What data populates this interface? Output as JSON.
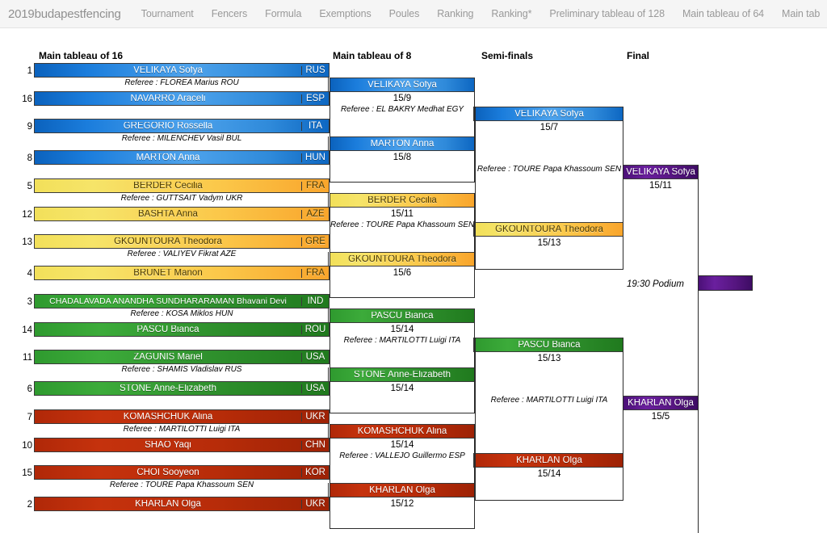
{
  "navbar": {
    "brand": "2019budapestfencing",
    "items": [
      {
        "label": "Tournament"
      },
      {
        "label": "Fencers"
      },
      {
        "label": "Formula"
      },
      {
        "label": "Exemptions"
      },
      {
        "label": "Poules"
      },
      {
        "label": "Ranking"
      },
      {
        "label": "Ranking*"
      },
      {
        "label": "Preliminary tableau of 128"
      },
      {
        "label": "Main tableau of 64"
      },
      {
        "label": "Main tab"
      }
    ]
  },
  "colors": {
    "blue": "#1b7ddc",
    "yellow": "#f6e469",
    "orange": "#f9a52c",
    "green": "#2e8f2c",
    "red": "#b72c09",
    "purple": "#55157f"
  },
  "columns": [
    {
      "label": "Main tableau of 16"
    },
    {
      "label": "Main tableau of 8"
    },
    {
      "label": "Semi-finals"
    },
    {
      "label": "Final"
    }
  ],
  "round_of_16": [
    {
      "seed": "1",
      "name": "VELIKAYA Sofya",
      "country": "RUS",
      "theme": "t-blue"
    },
    {
      "seed": "16",
      "name": "NAVARRO Araceli",
      "country": "ESP",
      "theme": "t-blue"
    },
    {
      "seed": "9",
      "name": "GREGORIO Rossella",
      "country": "ITA",
      "theme": "t-blue"
    },
    {
      "seed": "8",
      "name": "MARTON Anna",
      "country": "HUN",
      "theme": "t-blue"
    },
    {
      "seed": "5",
      "name": "BERDER Cecilia",
      "country": "FRA",
      "theme": "t-yellow"
    },
    {
      "seed": "12",
      "name": "BASHTA Anna",
      "country": "AZE",
      "theme": "t-yellow"
    },
    {
      "seed": "13",
      "name": "GKOUNTOURA Theodora",
      "country": "GRE",
      "theme": "t-yellow"
    },
    {
      "seed": "4",
      "name": "BRUNET Manon",
      "country": "FRA",
      "theme": "t-yellow"
    },
    {
      "seed": "3",
      "name": "CHADALAVADA ANANDHA SUNDHARARAMAN Bhavani Devi",
      "country": "IND",
      "theme": "t-green"
    },
    {
      "seed": "14",
      "name": "PASCU Bianca",
      "country": "ROU",
      "theme": "t-green"
    },
    {
      "seed": "11",
      "name": "ZAGUNIS Mariel",
      "country": "USA",
      "theme": "t-green"
    },
    {
      "seed": "6",
      "name": "STONE Anne-Elizabeth",
      "country": "USA",
      "theme": "t-green"
    },
    {
      "seed": "7",
      "name": "KOMASHCHUK Alina",
      "country": "UKR",
      "theme": "t-red"
    },
    {
      "seed": "10",
      "name": "SHAO Yaqi",
      "country": "CHN",
      "theme": "t-red"
    },
    {
      "seed": "15",
      "name": "CHOI Sooyeon",
      "country": "KOR",
      "theme": "t-red"
    },
    {
      "seed": "2",
      "name": "KHARLAN Olga",
      "country": "UKR",
      "theme": "t-red"
    }
  ],
  "referees_r16": [
    {
      "text": "Referee : FLOREA Marius ROU"
    },
    {
      "text": "Referee : MILENCHEV Vasil BUL"
    },
    {
      "text": "Referee : GUTTSAIT Vadym UKR"
    },
    {
      "text": "Referee : VALIYEV Fikrat AZE"
    },
    {
      "text": "Referee : KOSA Miklos HUN"
    },
    {
      "text": "Referee : SHAMIS Vladislav RUS"
    },
    {
      "text": "Referee : MARTILOTTI Luigi ITA"
    },
    {
      "text": "Referee : TOURE Papa Khassoum SEN"
    }
  ],
  "tableau_of_8": [
    {
      "name": "VELIKAYA Sofya",
      "score": "15/9",
      "theme": "t-blue"
    },
    {
      "name": "MARTON Anna",
      "score": "15/8",
      "theme": "t-blue"
    },
    {
      "name": "BERDER Cecilia",
      "score": "15/11",
      "theme": "t-yellow"
    },
    {
      "name": "GKOUNTOURA Theodora",
      "score": "15/6",
      "theme": "t-yellow"
    },
    {
      "name": "PASCU Bianca",
      "score": "15/14",
      "theme": "t-green"
    },
    {
      "name": "STONE Anne-Elizabeth",
      "score": "15/14",
      "theme": "t-green"
    },
    {
      "name": "KOMASHCHUK Alina",
      "score": "15/14",
      "theme": "t-red"
    },
    {
      "name": "KHARLAN Olga",
      "score": "15/12",
      "theme": "t-red"
    }
  ],
  "referees_t8": [
    {
      "text": "Referee : EL BAKRY Medhat EGY"
    },
    {
      "text": "Referee : TOURE Papa Khassoum SEN"
    },
    {
      "text": "Referee : MARTILOTTI Luigi ITA"
    },
    {
      "text": "Referee : VALLEJO Guillermo ESP"
    }
  ],
  "semi_finals": [
    {
      "name": "VELIKAYA Sofya",
      "score": "15/7",
      "theme": "t-blue"
    },
    {
      "name": "GKOUNTOURA Theodora",
      "score": "15/13",
      "theme": "t-yellow"
    },
    {
      "name": "PASCU Bianca",
      "score": "15/13",
      "theme": "t-green"
    },
    {
      "name": "KHARLAN Olga",
      "score": "15/14",
      "theme": "t-red"
    }
  ],
  "referees_sf": [
    {
      "text": "Referee : TOURE Papa Khassoum SEN"
    },
    {
      "text": "Referee : MARTILOTTI Luigi ITA"
    }
  ],
  "final": [
    {
      "name": "VELIKAYA Sofya",
      "score": "15/11",
      "theme": "t-purple"
    },
    {
      "name": "KHARLAN Olga",
      "score": "15/5",
      "theme": "t-purple"
    }
  ],
  "final_note": {
    "text": "19:30 Podium"
  },
  "champion": {
    "name": "",
    "theme": "t-purple"
  }
}
